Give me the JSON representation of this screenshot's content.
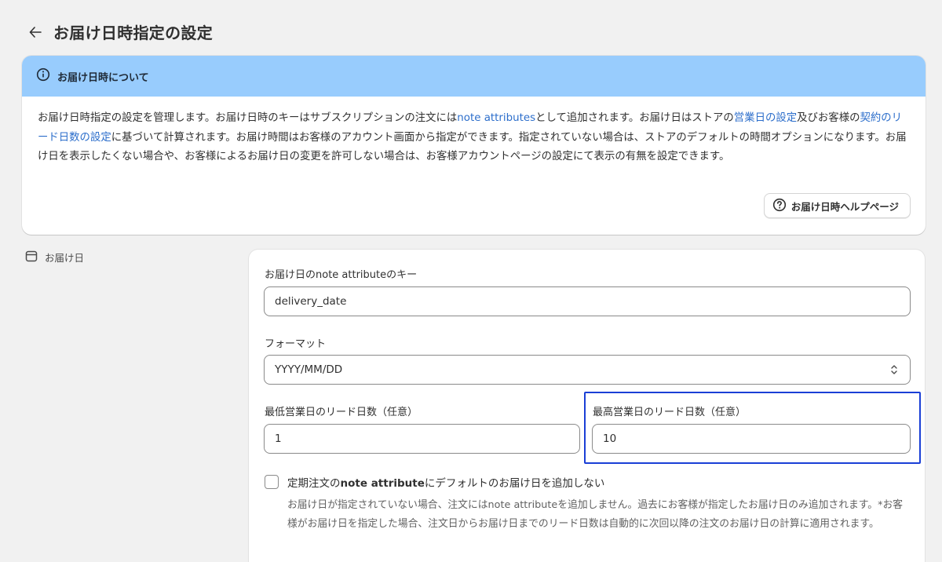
{
  "header": {
    "title": "お届け日時指定の設定"
  },
  "banner": {
    "title": "お届け日時について",
    "body": {
      "p1": "お届け日時指定の設定を管理します。お届け日時のキーはサブスクリプションの注文には",
      "link1": "note attributes",
      "p2": "として追加されます。お届け日はストアの",
      "link2": "営業日の設定",
      "p3": "及びお客様の",
      "link3": "契約のリード日数の設定",
      "p4": "に基づいて計算されます。お届け時間はお客様のアカウント画面から指定ができます。指定されていない場合は、ストアのデフォルトの時間オプションになります。お届け日を表示したくない場合や、お客様によるお届け日の変更を許可しない場合は、お客様アカウントページの設定にて表示の有無を設定できます。"
    },
    "help_button": "お届け日時ヘルプページ"
  },
  "section": {
    "label": "お届け日"
  },
  "form": {
    "key_label": "お届け日のnote attributeのキー",
    "key_value": "delivery_date",
    "format_label": "フォーマット",
    "format_value": "YYYY/MM/DD",
    "min_lead_label": "最低営業日のリード日数（任意）",
    "min_lead_value": "1",
    "max_lead_label": "最高営業日のリード日数（任意）",
    "max_lead_value": "10",
    "checkbox": {
      "prefix": "定期注文の",
      "bold": "note attribute",
      "suffix": "にデフォルトのお届け日を追加しない",
      "checked": false,
      "help": "お届け日が指定されていない場合、注文にはnote attributeを追加しません。過去にお客様が指定したお届け日のみ追加されます。*お客様がお届け日を指定した場合、注文日からお届け日までのリード日数は自動的に次回以降の注文のお届け日の計算に適用されます。"
    }
  },
  "colors": {
    "banner_bg": "#98ccfd",
    "link": "#2c6ecb",
    "highlight_border": "#1a3fd6"
  }
}
